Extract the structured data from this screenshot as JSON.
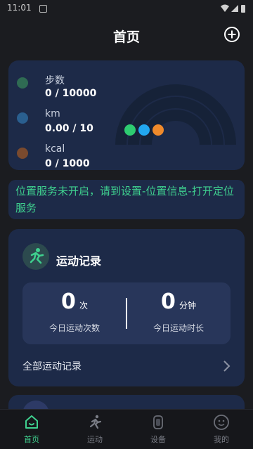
{
  "status_bar": {
    "time": "11:01"
  },
  "header": {
    "title": "首页"
  },
  "stats": {
    "steps": {
      "label": "步数",
      "value": "0 / 10000"
    },
    "distance": {
      "label": "km",
      "value": "0.00 / 10"
    },
    "calories": {
      "label": "kcal",
      "value": "0 / 1000"
    },
    "colors": {
      "steps": "#2ecc71",
      "distance": "#22a7f0",
      "calories": "#f08a2b"
    }
  },
  "notice": {
    "text": "位置服务未开启，请到设置-位置信息-打开定位服务"
  },
  "exercise": {
    "title": "运动记录",
    "count_value": "0",
    "count_unit": "次",
    "count_label": "今日运动次数",
    "duration_value": "0",
    "duration_unit": "分钟",
    "duration_label": "今日运动时长",
    "all_records_label": "全部运动记录"
  },
  "tabs": [
    {
      "label": "首页",
      "icon": "home-icon",
      "active": true
    },
    {
      "label": "运动",
      "icon": "running-icon",
      "active": false
    },
    {
      "label": "设备",
      "icon": "watch-icon",
      "active": false
    },
    {
      "label": "我的",
      "icon": "profile-icon",
      "active": false
    }
  ],
  "theme": {
    "accent": "#3fd18f",
    "card": "#1d2a48",
    "background": "#1b1c20"
  }
}
